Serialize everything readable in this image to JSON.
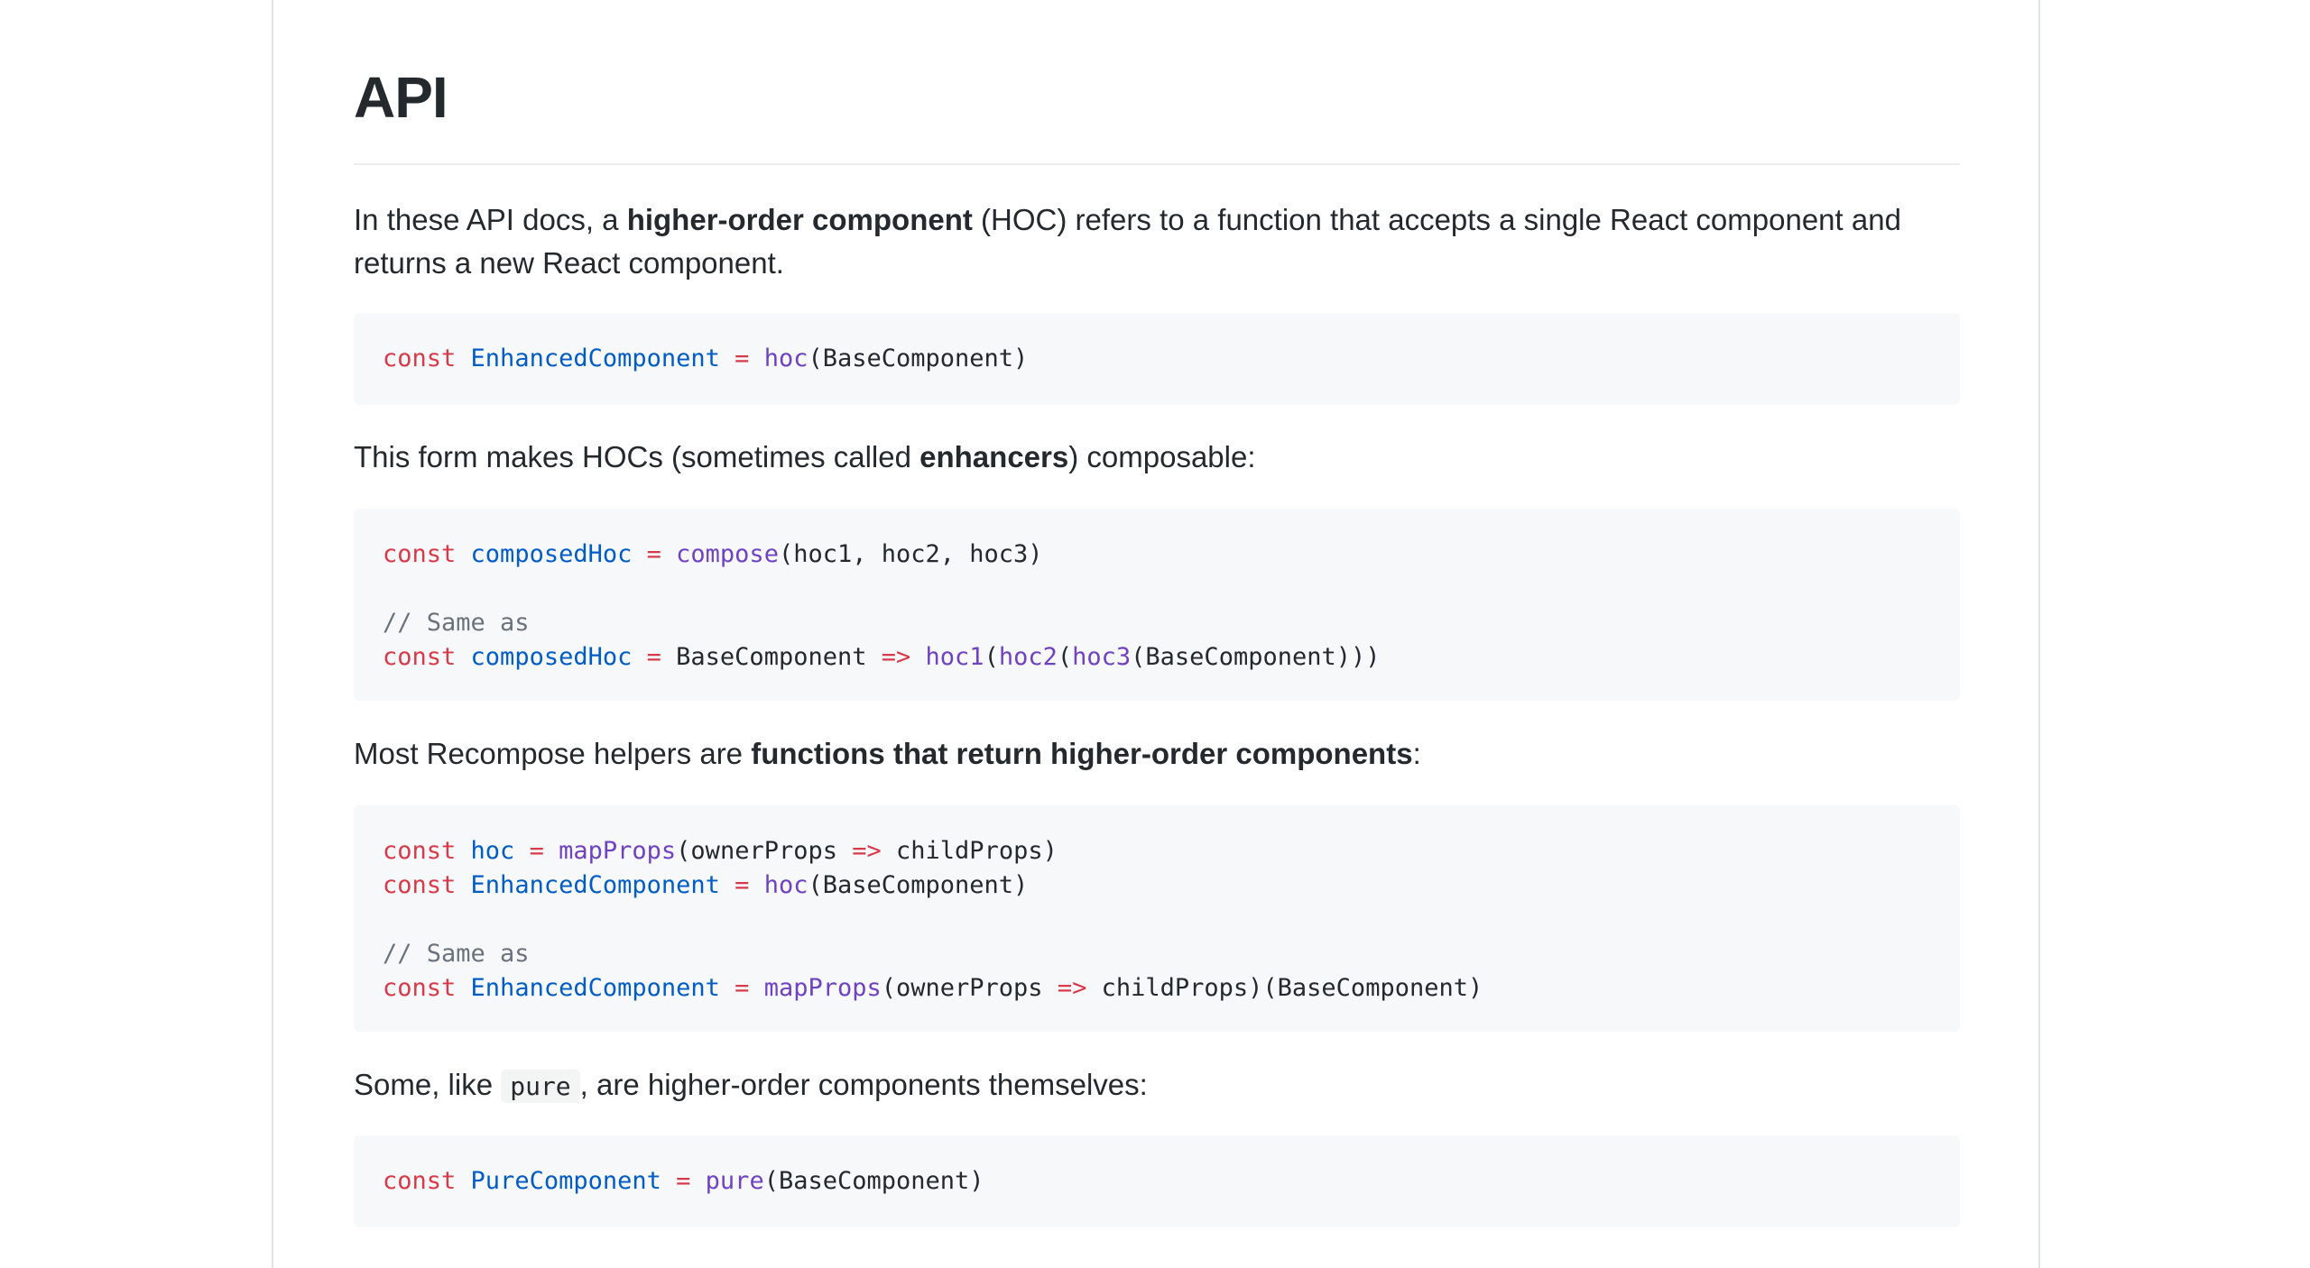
{
  "heading": "API",
  "para1": {
    "pre": "In these API docs, a ",
    "bold": "higher-order component",
    "post": " (HOC) refers to a function that accepts a single React component and returns a new React component."
  },
  "code1": {
    "line1": {
      "k": "const",
      "v": "EnhancedComponent",
      "eq": "=",
      "f": "hoc",
      "rest": "(BaseComponent)"
    }
  },
  "para2": {
    "pre": "This form makes HOCs (sometimes called ",
    "bold": "enhancers",
    "post": ") composable:"
  },
  "code2": {
    "line1": {
      "k": "const",
      "v": "composedHoc",
      "eq": "=",
      "f": "compose",
      "rest": "(hoc1, hoc2, hoc3)"
    },
    "comment": "// Same as",
    "line2": {
      "k": "const",
      "v": "composedHoc",
      "eq": "=",
      "base": "BaseComponent",
      "arrow": "=>",
      "f1": "hoc1",
      "p1": "(",
      "f2": "hoc2",
      "p2": "(",
      "f3": "hoc3",
      "rest": "(BaseComponent)))"
    }
  },
  "para3": {
    "pre": "Most Recompose helpers are ",
    "bold": "functions that return higher-order components",
    "post": ":"
  },
  "code3": {
    "line1": {
      "k": "const",
      "v": "hoc",
      "eq": "=",
      "f": "mapProps",
      "arg": "(ownerProps",
      "arrow": "=>",
      "rest": "childProps)"
    },
    "line2": {
      "k": "const",
      "v": "EnhancedComponent",
      "eq": "=",
      "f": "hoc",
      "rest": "(BaseComponent)"
    },
    "comment": "// Same as",
    "line3": {
      "k": "const",
      "v": "EnhancedComponent",
      "eq": "=",
      "f": "mapProps",
      "arg": "(ownerProps",
      "arrow": "=>",
      "rest": "childProps)(BaseComponent)"
    }
  },
  "para4": {
    "pre": "Some, like ",
    "code": "pure",
    "post": ", are higher-order components themselves:"
  },
  "code4": {
    "line1": {
      "k": "const",
      "v": "PureComponent",
      "eq": "=",
      "f": "pure",
      "rest": "(BaseComponent)"
    }
  }
}
